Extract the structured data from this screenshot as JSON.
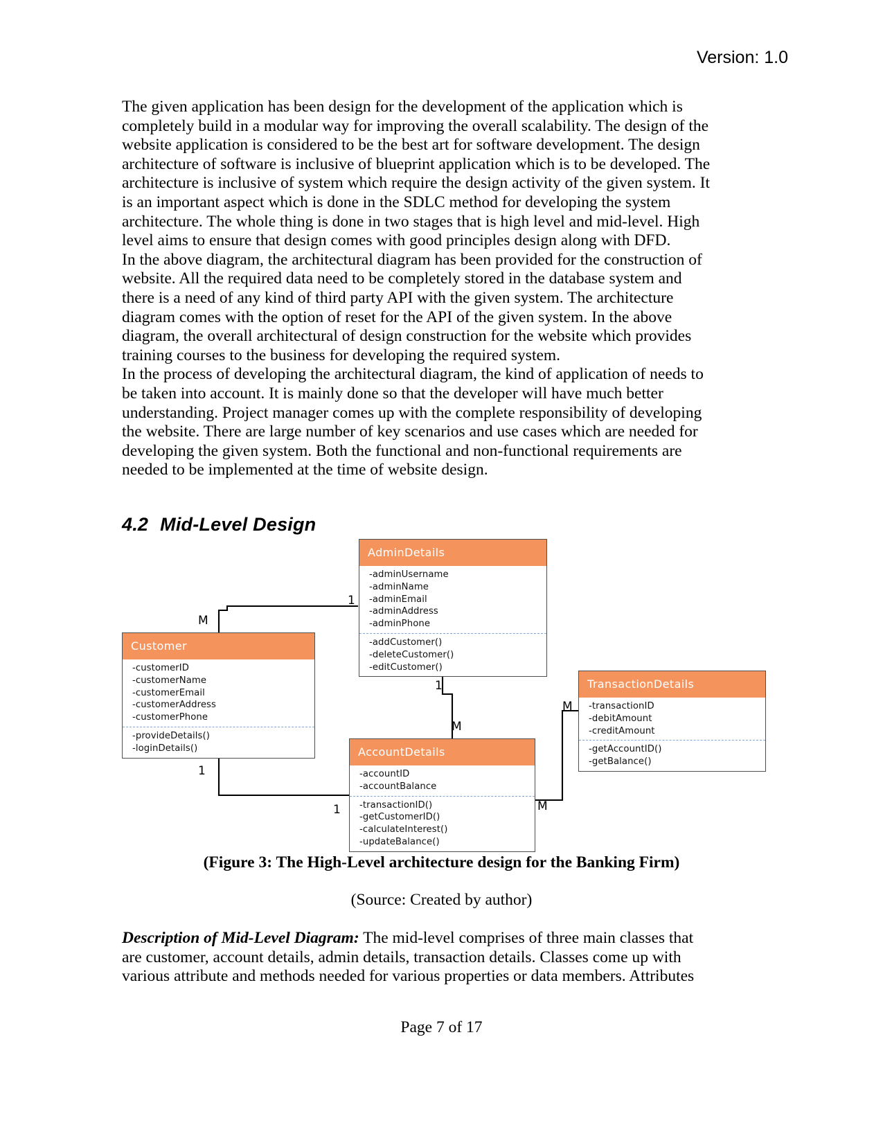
{
  "header": {
    "version": "Version: 1.0"
  },
  "body": {
    "paragraph1": "The given application has been design for the development of the application which is completely build in a modular way for improving the overall scalability. The design of the website application is considered to be the best art for software development. The design architecture of software is inclusive of blueprint application which is to be developed. The architecture is inclusive of system which require the design activity of the given system. It is an important aspect which is done in the SDLC method for developing the system architecture. The whole thing is done in two stages that is high level and mid-level. High level aims to ensure that design comes with good principles design along with DFD.",
    "paragraph2": "In the above diagram, the architectural diagram has been provided for the construction of website. All the required data need to be completely stored in the database system and there is a need of any kind of third party API with the given system. The architecture diagram comes with the option of reset for the API of the given system. In the above diagram, the overall architectural of design construction for the website which provides training courses to the business for developing the required system.",
    "paragraph3": "In the process of developing the architectural diagram, the kind of application of needs to be taken into account. It is mainly done so that the developer will have much better understanding. Project manager comes up with the complete responsibility of developing the website. There are large number of key scenarios and use cases which are needed for developing the given system. Both the functional and non-functional requirements are needed to be implemented at the time of website design."
  },
  "section": {
    "number": "4.2",
    "title": "Mid-Level Design"
  },
  "diagram": {
    "accent_color": "#F4945C",
    "separator_color": "#7fa8d6",
    "classes": [
      {
        "id": "admin-details",
        "name": "AdminDetails",
        "attributes": [
          "-adminUsername",
          "-adminName",
          "-adminEmail",
          "-adminAddress",
          "-adminPhone"
        ],
        "methods": [
          "-addCustomer()",
          "-deleteCustomer()",
          "-editCustomer()"
        ]
      },
      {
        "id": "customer",
        "name": "Customer",
        "attributes": [
          "-customerID",
          "-customerName",
          "-customerEmail",
          "-customerAddress",
          "-customerPhone"
        ],
        "methods": [
          "-provideDetails()",
          "-loginDetails()"
        ]
      },
      {
        "id": "transaction-details",
        "name": "TransactionDetails",
        "attributes": [
          "-transactionID",
          "-debitAmount",
          "-creditAmount"
        ],
        "methods": [
          "-getAccountID()",
          "-getBalance()"
        ]
      },
      {
        "id": "account-details",
        "name": "AccountDetails",
        "attributes": [
          "-accountID",
          "-accountBalance"
        ],
        "methods": [
          "-transactionID()",
          "-getCustomerID()",
          "-calculateInterest()",
          "-updateBalance()"
        ]
      }
    ],
    "multiplicities": [
      {
        "id": "admin-one",
        "label": "1"
      },
      {
        "id": "customer-m",
        "label": "M"
      },
      {
        "id": "customer-one",
        "label": "1"
      },
      {
        "id": "admin-account-one",
        "label": "1"
      },
      {
        "id": "account-m-top",
        "label": "M"
      },
      {
        "id": "transaction-m",
        "label": "M"
      },
      {
        "id": "account-one-left",
        "label": "1"
      },
      {
        "id": "account-m-right",
        "label": "M"
      }
    ]
  },
  "captions": {
    "figure": "(Figure 3: The High-Level architecture design for the Banking Firm)",
    "source": "(Source: Created by author)"
  },
  "description": {
    "lead": "Description of Mid-Level Diagram:",
    "text": " The mid-level comprises of three main classes that are customer, account details, admin details, transaction details. Classes come up with various attribute and methods needed for various properties or data members. Attributes"
  },
  "footer": {
    "page": "Page 7 of 17"
  }
}
